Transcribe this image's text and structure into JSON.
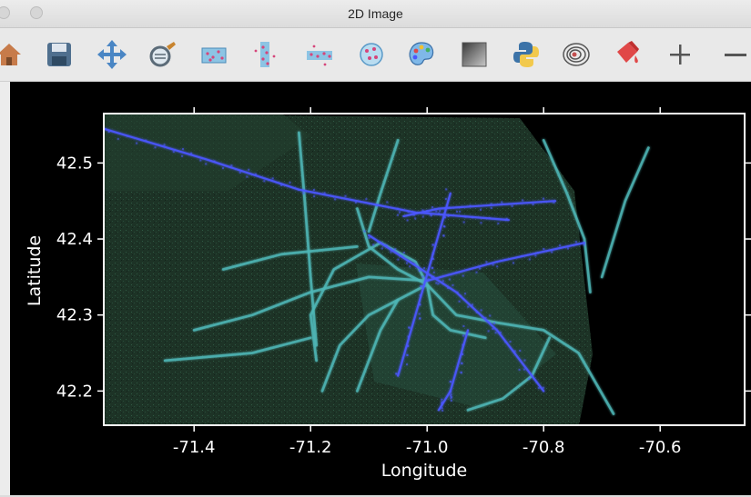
{
  "window": {
    "title": "2D Image"
  },
  "toolbar": {
    "tools": [
      {
        "name": "home-icon"
      },
      {
        "name": "save-icon"
      },
      {
        "name": "pan-icon"
      },
      {
        "name": "zoom-lens-icon"
      },
      {
        "name": "scatter-box-icon"
      },
      {
        "name": "vertical-strip-icon"
      },
      {
        "name": "horizontal-strip-icon"
      },
      {
        "name": "circle-points-icon"
      },
      {
        "name": "palette-icon"
      },
      {
        "name": "gradient-square-icon"
      },
      {
        "name": "python-icon"
      },
      {
        "name": "contour-icon"
      },
      {
        "name": "paint-bucket-icon"
      },
      {
        "name": "plus-icon"
      },
      {
        "name": "minus-icon"
      }
    ]
  },
  "colors": {
    "frame": "#ffffff",
    "background": "#000000",
    "land": "#1f3a2a",
    "road_teal": "#4fb8b8",
    "road_blue": "#4b57ff"
  },
  "chart_data": {
    "type": "heatmap",
    "title": "",
    "xlabel": "Longitude",
    "ylabel": "Latitude",
    "xlim": [
      -71.555,
      -70.455
    ],
    "ylim": [
      42.155,
      42.565
    ],
    "x_ticks": [
      -71.4,
      -71.2,
      -71.0,
      -70.8,
      -70.6
    ],
    "x_tick_labels": [
      "-71.4",
      "-71.2",
      "-71.0",
      "-70.8",
      "-70.6"
    ],
    "y_ticks": [
      42.2,
      42.3,
      42.4,
      42.5
    ],
    "y_tick_labels": [
      "42.2",
      "42.3",
      "42.4",
      "42.5"
    ],
    "grid": false,
    "legend": "none",
    "series": [
      {
        "paths": [
          [
            [
              -71.555,
              42.545
            ],
            [
              -71.38,
              42.505
            ],
            [
              -71.22,
              42.465
            ],
            [
              -71.02,
              42.435
            ],
            [
              -70.86,
              42.425
            ]
          ],
          [
            [
              -71.1,
              42.405
            ],
            [
              -71.03,
              42.37
            ],
            [
              -70.95,
              42.33
            ],
            [
              -70.88,
              42.28
            ],
            [
              -70.8,
              42.2
            ]
          ],
          [
            [
              -70.96,
              42.46
            ],
            [
              -70.99,
              42.38
            ],
            [
              -71.02,
              42.3
            ],
            [
              -71.05,
              42.22
            ]
          ],
          [
            [
              -71.0,
              42.345
            ],
            [
              -70.88,
              42.37
            ],
            [
              -70.73,
              42.395
            ]
          ],
          [
            [
              -70.93,
              42.28
            ],
            [
              -70.96,
              42.2
            ],
            [
              -70.98,
              42.175
            ]
          ],
          [
            [
              -71.04,
              42.43
            ],
            [
              -70.98,
              42.44
            ],
            [
              -70.78,
              42.45
            ]
          ]
        ]
      },
      {
        "paths": [
          [
            [
              -71.12,
              42.44
            ],
            [
              -71.1,
              42.39
            ],
            [
              -71.05,
              42.36
            ],
            [
              -71.0,
              42.34
            ]
          ],
          [
            [
              -71.0,
              42.34
            ],
            [
              -70.95,
              42.3
            ],
            [
              -70.88,
              42.29
            ],
            [
              -70.8,
              42.28
            ],
            [
              -70.74,
              42.25
            ],
            [
              -70.68,
              42.17
            ]
          ],
          [
            [
              -71.0,
              42.34
            ],
            [
              -71.05,
              42.32
            ],
            [
              -71.1,
              42.3
            ],
            [
              -71.15,
              42.26
            ],
            [
              -71.18,
              42.2
            ]
          ],
          [
            [
              -71.19,
              42.24
            ],
            [
              -71.2,
              42.3
            ],
            [
              -71.16,
              42.36
            ],
            [
              -71.08,
              42.395
            ],
            [
              -71.02,
              42.37
            ],
            [
              -71.0,
              42.34
            ]
          ],
          [
            [
              -71.0,
              42.34
            ],
            [
              -70.99,
              42.3
            ],
            [
              -70.96,
              42.28
            ],
            [
              -70.9,
              42.27
            ]
          ],
          [
            [
              -71.05,
              42.32
            ],
            [
              -71.08,
              42.28
            ],
            [
              -71.1,
              42.24
            ],
            [
              -71.12,
              42.2
            ]
          ],
          [
            [
              -70.79,
              42.27
            ],
            [
              -70.82,
              42.22
            ],
            [
              -70.87,
              42.19
            ],
            [
              -70.93,
              42.175
            ]
          ],
          [
            [
              -70.8,
              42.53
            ],
            [
              -70.76,
              42.46
            ],
            [
              -70.73,
              42.4
            ],
            [
              -70.72,
              42.33
            ]
          ],
          [
            [
              -71.4,
              42.28
            ],
            [
              -71.3,
              42.3
            ],
            [
              -71.2,
              42.33
            ],
            [
              -71.1,
              42.35
            ],
            [
              -71.0,
              42.345
            ]
          ],
          [
            [
              -71.35,
              42.36
            ],
            [
              -71.25,
              42.38
            ],
            [
              -71.12,
              42.39
            ]
          ],
          [
            [
              -71.45,
              42.24
            ],
            [
              -71.3,
              42.25
            ],
            [
              -71.2,
              42.27
            ]
          ],
          [
            [
              -71.22,
              42.54
            ],
            [
              -71.21,
              42.45
            ],
            [
              -71.2,
              42.35
            ],
            [
              -71.19,
              42.26
            ]
          ],
          [
            [
              -71.05,
              42.53
            ],
            [
              -71.08,
              42.46
            ],
            [
              -71.1,
              42.41
            ]
          ],
          [
            [
              -70.62,
              42.52
            ],
            [
              -70.66,
              42.45
            ],
            [
              -70.7,
              42.35
            ]
          ]
        ]
      }
    ]
  }
}
